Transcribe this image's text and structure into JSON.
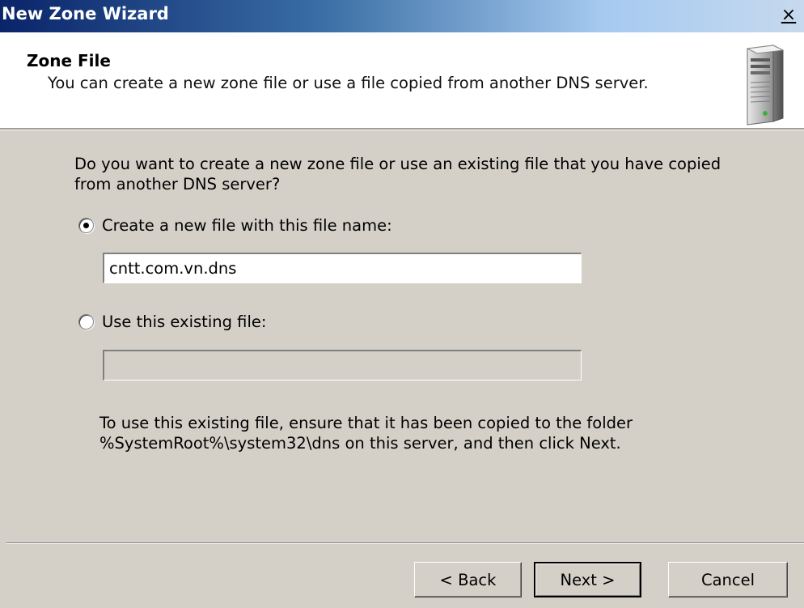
{
  "window": {
    "title": "New Zone Wizard",
    "close_glyph": "×"
  },
  "header": {
    "title": "Zone File",
    "subtitle": "You can create a new zone file or use a file copied from another DNS server.",
    "icon": "server-icon"
  },
  "content": {
    "question_line1": "Do you want to create a new zone file or use an existing file that you have copied",
    "question_line2": "from another DNS server?",
    "option_new": {
      "label": "Create a new file with this file name:",
      "selected": true,
      "value": "cntt.com.vn.dns"
    },
    "option_existing": {
      "label": "Use this existing file:",
      "selected": false,
      "value": ""
    },
    "note_line1": "To use this existing file, ensure that it has been copied to the folder",
    "note_line2": "%SystemRoot%\\system32\\dns on this server, and then click Next."
  },
  "buttons": {
    "back": "< Back",
    "next": "Next >",
    "cancel": "Cancel"
  },
  "colors": {
    "dialog_bg": "#d4d0c8",
    "title_bar_start": "#0a246a",
    "title_bar_end": "#a6caf0"
  }
}
